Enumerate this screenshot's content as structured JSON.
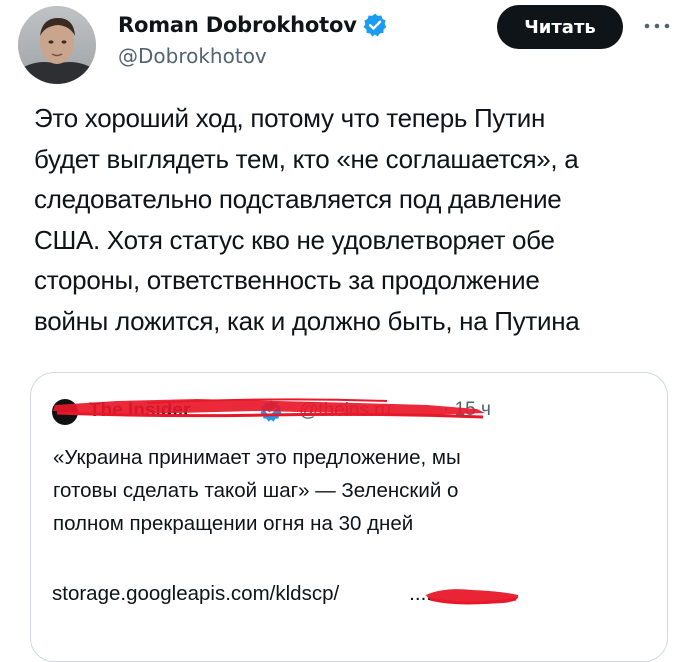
{
  "tweet": {
    "author": {
      "display_name": "Roman Dobrokhotov",
      "handle": "@Dobrokhotov",
      "verified_icon": "verified-badge-icon"
    },
    "follow_label": "Читать",
    "more_icon": "more-options-icon",
    "text": "Это хороший ход, потому что теперь Путин\nбудет выглядеть тем, кто «не соглашается», а\nследовательно подставляется под давление\nСША. Хотя статус кво не удовлетворяет обе\nстороны, ответственность за продолжение\nвойны ложится, как и должно быть, на Путина"
  },
  "quote": {
    "author_name": "The Insider",
    "author_handle": "@theins.ru",
    "time": "· 15 ч",
    "text": "«Украина принимает это предложение, мы\nготовы сделать такой шаг» — Зеленский о\nполном прекращении огня на 30 дней",
    "link": "storage.googleapis.com/kldscp/",
    "link_suffix": "....",
    "accent_color": "#1d9bf0",
    "redaction_color": "#e8182a"
  }
}
